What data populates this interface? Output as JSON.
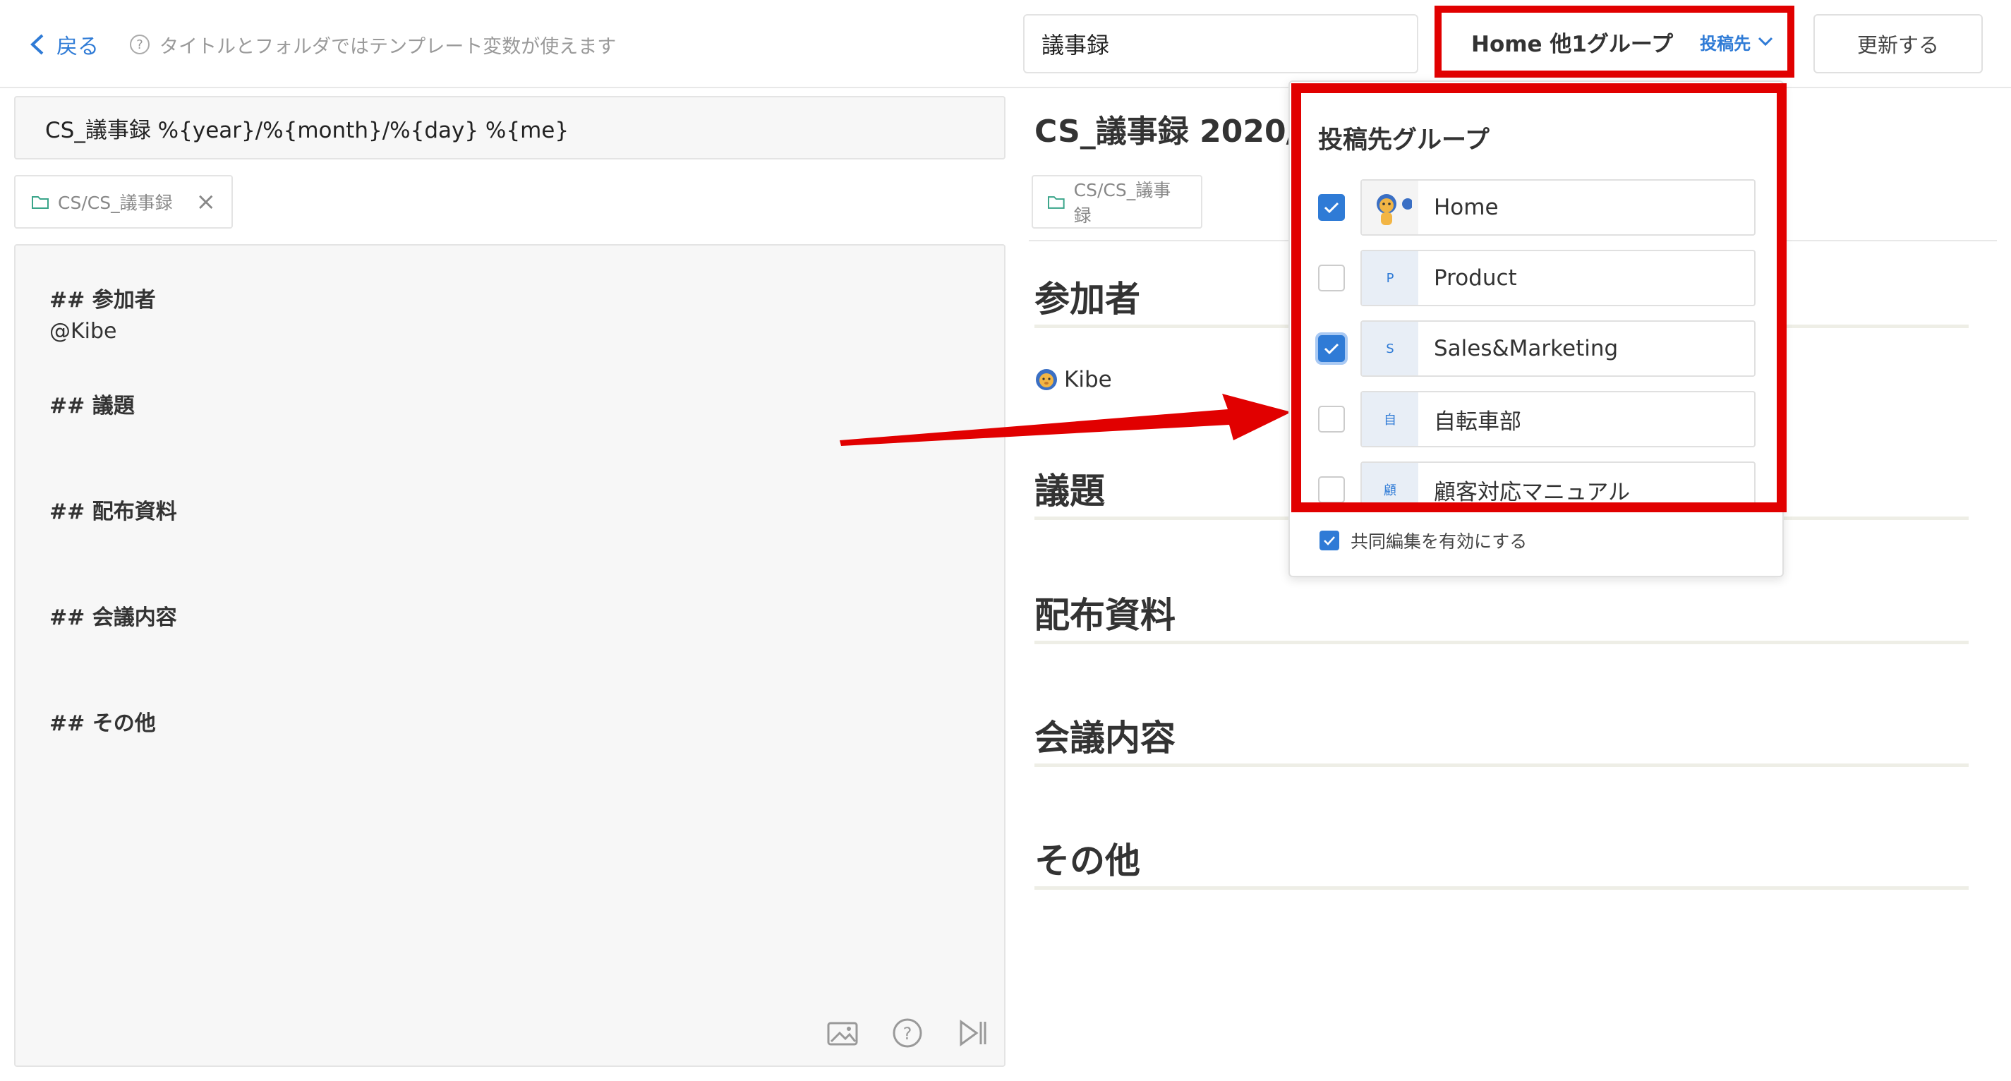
{
  "header": {
    "back_label": "戻る",
    "hint": "タイトルとフォルダではテンプレート変数が使えます",
    "title_input_value": "議事録",
    "group_button_label": "Home 他1グループ",
    "group_button_sub": "投稿先",
    "update_button": "更新する"
  },
  "editor": {
    "title_value": "CS_議事録 %{year}/%{month}/%{day} %{me}",
    "folder": "CS/CS_議事録",
    "lines": {
      "h1": "## 参加者",
      "t1": "@Kibe",
      "h2": "## 議題",
      "h3": "## 配布資料",
      "h4": "## 会議内容",
      "h5": "## その他"
    }
  },
  "preview": {
    "title": "CS_議事録 2020/0",
    "folder": "CS/CS_議事録",
    "headings": [
      "参加者",
      "議題",
      "配布資料",
      "会議内容",
      "その他"
    ],
    "kibe": "Kibe"
  },
  "dropdown": {
    "title": "投稿先グループ",
    "groups": [
      {
        "name": "Home",
        "icon": "lion-avatar",
        "checked": true
      },
      {
        "name": "Product",
        "icon": "P",
        "checked": false
      },
      {
        "name": "Sales&Marketing",
        "icon": "S",
        "checked": true
      },
      {
        "name": "自転車部",
        "icon": "自",
        "checked": false
      },
      {
        "name": "顧客対応マニュアル",
        "icon": "顧",
        "checked": false
      }
    ],
    "collab_label": "共同編集を有効にする",
    "collab_checked": true
  },
  "colors": {
    "accent": "#2f7bd6",
    "highlight_red": "#e10000"
  }
}
